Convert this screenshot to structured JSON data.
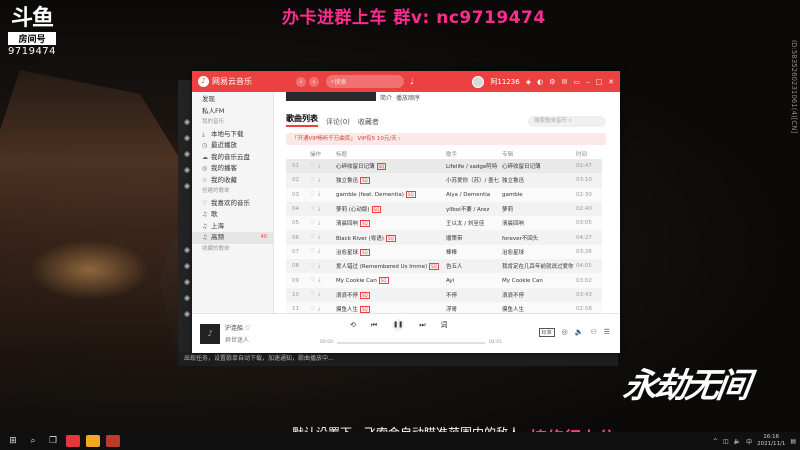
{
  "stream": {
    "logo_brand": "斗鱼",
    "logo_tag": "房间号",
    "room_number": "9719474",
    "top_banner": "办卡进群上车 群v: nc9719474",
    "side_id": "ID:5835260231061(4)[CN]",
    "watermark": "永劫无间",
    "subtitle": "默认设置下，飞索会自动瞄准范围内的敌人。",
    "overlay_text": "接修行上分"
  },
  "app": {
    "name": "网易云音乐",
    "search_placeholder": "搜索",
    "user_name": "阿11236",
    "back_label": "‹",
    "forward_label": "›",
    "mic_icon": "mic-icon",
    "colors": {
      "accent": "#ec4141",
      "vip": "#c84a3a"
    }
  },
  "sidebar": {
    "items": [
      {
        "label": "发现",
        "section": false,
        "icon": ""
      },
      {
        "label": "私人FM",
        "section": false,
        "icon": ""
      },
      {
        "label": "我的音乐",
        "section": true,
        "icon": ""
      },
      {
        "label": "本地与下载",
        "section": false,
        "icon": "⤓"
      },
      {
        "label": "最近播放",
        "section": false,
        "icon": "◷"
      },
      {
        "label": "我的音乐云盘",
        "section": false,
        "icon": "☁"
      },
      {
        "label": "我的播客",
        "section": false,
        "icon": "◎"
      },
      {
        "label": "我的收藏",
        "section": false,
        "icon": "☆"
      },
      {
        "label": "创建的歌单",
        "section": true,
        "icon": ""
      },
      {
        "label": "我喜欢的音乐",
        "section": false,
        "icon": "♡"
      },
      {
        "label": "歌",
        "section": false,
        "icon": "♫"
      },
      {
        "label": "上海",
        "section": false,
        "icon": "♫"
      },
      {
        "label": "高频",
        "section": false,
        "icon": "♫",
        "active": true
      },
      {
        "label": "收藏的歌单",
        "section": true,
        "icon": ""
      }
    ],
    "count_badge": "40"
  },
  "playlist": {
    "header_links": [
      "简介",
      "播放顺序"
    ],
    "tabs": [
      "歌曲列表",
      "评论(0)",
      "收藏者"
    ],
    "search_placeholder": "搜索歌单音乐",
    "vip_banner": "「开通VIP畅听千万曲库」 VIP仅5 10元/天 ›",
    "columns": [
      "操作",
      "标题",
      "歌手",
      "专辑",
      "时间"
    ],
    "songs": [
      {
        "idx": "01",
        "title": "心碎收留日记薄",
        "badge": "SQ",
        "artist": "Lifelife / sadge阿特",
        "album": "心碎收留日记薄",
        "time": "02:47"
      },
      {
        "idx": "02",
        "title": "独立鲁迅",
        "badge": "SQ",
        "artist": "小苏爱你（苏）/ 墨七",
        "album": "独立鲁迅",
        "time": "03:10"
      },
      {
        "idx": "03",
        "title": "gamble (feat. Dementia)",
        "badge": "SQ",
        "artist": "Alya / Dementia",
        "album": "gamble",
        "time": "02:30"
      },
      {
        "idx": "04",
        "title": "萝莉 (心动版)",
        "badge": "SQ",
        "artist": "yllboi不要 / Arez",
        "album": "萝莉",
        "time": "02:40"
      },
      {
        "idx": "05",
        "title": "清晨回响",
        "badge": "SQ",
        "artist": "王以太 / 刘至佳",
        "album": "清晨回响",
        "time": "03:05"
      },
      {
        "idx": "06",
        "title": "Black River (粤语)",
        "badge": "SQ",
        "artist": "顺策带",
        "album": "forever不回头",
        "time": "04:27"
      },
      {
        "idx": "07",
        "title": "治愈星球",
        "badge": "SQ",
        "artist": "棒棒",
        "album": "治愈星球",
        "time": "03:26"
      },
      {
        "idx": "08",
        "title": "爱人错过 (Remembered Us Imme)",
        "badge": "SQ",
        "artist": "告五人",
        "album": "我肯定在几百年前就说过爱你",
        "time": "04:05"
      },
      {
        "idx": "09",
        "title": "My Cookie Can",
        "badge": "SQ",
        "artist": "Ayi",
        "album": "My Cookie Can",
        "time": "03:02"
      },
      {
        "idx": "10",
        "title": "浪浪不停",
        "badge": "SQ",
        "artist": "不停",
        "album": "浪浪不停",
        "time": "03:43"
      },
      {
        "idx": "11",
        "title": "摸鱼人生",
        "badge": "SQ",
        "artist": "浮哥",
        "album": "摸鱼人生",
        "time": "02:58"
      }
    ],
    "highlight_row": 0
  },
  "player": {
    "title": "沪连船",
    "artist": "异世迷人",
    "elapsed": "00:00",
    "duration": "04:05",
    "progress_fraction": 0.0,
    "quality": "标准"
  },
  "background_window": {
    "status_text": "出现任务，设置歌单自动下载，加速通知，歌曲播放中..."
  },
  "taskbar": {
    "time": "16:16",
    "date": "2021/11/1",
    "lang": "中"
  }
}
